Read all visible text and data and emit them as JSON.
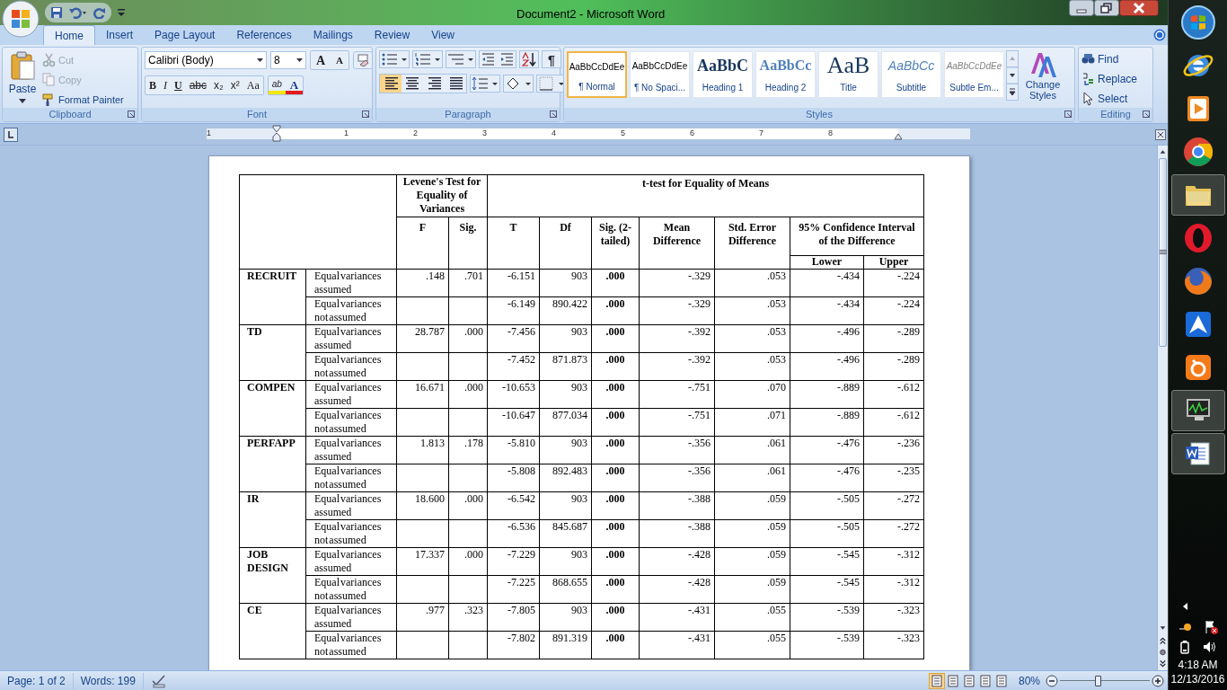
{
  "window": {
    "title": "Document2 - Microsoft Word"
  },
  "ribbon": {
    "tabs": [
      {
        "label": "Home",
        "selected": true
      },
      {
        "label": "Insert",
        "selected": false
      },
      {
        "label": "Page Layout",
        "selected": false
      },
      {
        "label": "References",
        "selected": false
      },
      {
        "label": "Mailings",
        "selected": false
      },
      {
        "label": "Review",
        "selected": false
      },
      {
        "label": "View",
        "selected": false
      }
    ],
    "clipboard": {
      "label": "Clipboard",
      "paste": "Paste",
      "items": [
        {
          "kind": "cut",
          "label": "Cut",
          "disabled": true
        },
        {
          "kind": "copy",
          "label": "Copy",
          "disabled": true
        },
        {
          "kind": "painter",
          "label": "Format Painter",
          "disabled": false
        }
      ]
    },
    "font": {
      "label": "Font",
      "family": "Calibri (Body)",
      "size": "8",
      "grow": "A",
      "shrink": "A",
      "buttons": [
        "B",
        "I",
        "U",
        "abc",
        "x₂",
        "x²",
        "Aa"
      ],
      "highlight": "ab",
      "font_color_button": "A"
    },
    "paragraph": {
      "label": "Paragraph",
      "pilcrow": "¶",
      "alignments": [
        {
          "selected": true
        },
        {
          "selected": false
        },
        {
          "selected": false
        },
        {
          "selected": false
        }
      ]
    },
    "styles": {
      "label": "Styles",
      "items": [
        {
          "preview": "AaBbCcDdEe",
          "name": "¶ Normal",
          "kind": "normal",
          "selected": true
        },
        {
          "preview": "AaBbCcDdEe",
          "name": "¶ No Spaci...",
          "kind": "normal",
          "selected": false
        },
        {
          "preview": "AaBbC",
          "name": "Heading 1",
          "kind": "heading1",
          "selected": false
        },
        {
          "preview": "AaBbCc",
          "name": "Heading 2",
          "kind": "heading2",
          "selected": false
        },
        {
          "preview": "AaB",
          "name": "Title",
          "kind": "title",
          "selected": false
        },
        {
          "preview": "AaBbCc",
          "name": "Subtitle",
          "kind": "subtitle",
          "selected": false
        },
        {
          "preview": "AaBbCcDdEe",
          "name": "Subtle Em...",
          "kind": "subtle",
          "selected": false
        }
      ],
      "change_styles": "Change Styles"
    },
    "editing": {
      "label": "Editing",
      "items": [
        {
          "kind": "find",
          "label": "Find"
        },
        {
          "kind": "replace",
          "label": "Replace"
        },
        {
          "kind": "select",
          "label": "Select"
        }
      ]
    }
  },
  "ruler": {
    "numbers": [
      "1",
      "1",
      "2",
      "3",
      "4",
      "5",
      "6",
      "7",
      "8"
    ]
  },
  "table": {
    "levene": "Levene's Test for Equality of Variances",
    "ttest": "t-test for Equality of Means",
    "columns": [
      "F",
      "Sig.",
      "T",
      "Df",
      "Sig. (2-tailed)",
      "Mean Difference",
      "Std. Error Difference"
    ],
    "ci": "95% Confidence Interval of the Difference",
    "ci_columns": [
      "Lower",
      "Upper"
    ],
    "groups": [
      {
        "name": "RECRUIT",
        "rows": [
          {
            "label": "Equal variances assumed",
            "values": [
              ".148",
              ".701",
              "-6.151",
              "903",
              ".000",
              "-.329",
              ".053",
              "-.434",
              "-.224"
            ]
          },
          {
            "label": "Equal variances not assumed",
            "values": [
              "-6.149",
              "890.422",
              ".000",
              "-.329",
              ".053",
              "-.434",
              "-.224"
            ]
          }
        ]
      },
      {
        "name": "TD",
        "rows": [
          {
            "label": "Equal variances assumed",
            "values": [
              "28.787",
              ".000",
              "-7.456",
              "903",
              ".000",
              "-.392",
              ".053",
              "-.496",
              "-.289"
            ]
          },
          {
            "label": "Equal variances not assumed",
            "values": [
              "-7.452",
              "871.873",
              ".000",
              "-.392",
              ".053",
              "-.496",
              "-.289"
            ]
          }
        ]
      },
      {
        "name": "COMPEN",
        "rows": [
          {
            "label": "Equal variances assumed",
            "values": [
              "16.671",
              ".000",
              "-10.653",
              "903",
              ".000",
              "-.751",
              ".070",
              "-.889",
              "-.612"
            ]
          },
          {
            "label": "Equal variances not assumed",
            "values": [
              "-10.647",
              "877.034",
              ".000",
              "-.751",
              ".071",
              "-.889",
              "-.612"
            ]
          }
        ]
      },
      {
        "name": "PERFAPP",
        "rows": [
          {
            "label": "Equal variances assumed",
            "values": [
              "1.813",
              ".178",
              "-5.810",
              "903",
              ".000",
              "-.356",
              ".061",
              "-.476",
              "-.236"
            ]
          },
          {
            "label": "Equal variances not assumed",
            "values": [
              "-5.808",
              "892.483",
              ".000",
              "-.356",
              ".061",
              "-.476",
              "-.235"
            ]
          }
        ]
      },
      {
        "name": "IR",
        "rows": [
          {
            "label": "Equal variances assumed",
            "values": [
              "18.600",
              ".000",
              "-6.542",
              "903",
              ".000",
              "-.388",
              ".059",
              "-.505",
              "-.272"
            ]
          },
          {
            "label": "Equal variances not assumed",
            "values": [
              "-6.536",
              "845.687",
              ".000",
              "-.388",
              ".059",
              "-.505",
              "-.272"
            ]
          }
        ]
      },
      {
        "name": "JOB DESIGN",
        "rows": [
          {
            "label": "Equal variances assumed",
            "values": [
              "17.337",
              ".000",
              "-7.229",
              "903",
              ".000",
              "-.428",
              ".059",
              "-.545",
              "-.312"
            ]
          },
          {
            "label": "Equal variances not assumed",
            "values": [
              "-7.225",
              "868.655",
              ".000",
              "-.428",
              ".059",
              "-.545",
              "-.312"
            ]
          }
        ]
      },
      {
        "name": "CE",
        "rows": [
          {
            "label": "Equal variances assumed",
            "values": [
              ".977",
              ".323",
              "-7.805",
              "903",
              ".000",
              "-.431",
              ".055",
              "-.539",
              "-.323"
            ]
          },
          {
            "label": "Equal variances not assumed",
            "values": [
              "-7.802",
              "891.319",
              ".000",
              "-.431",
              ".055",
              "-.539",
              "-.323"
            ]
          }
        ]
      }
    ]
  },
  "status_bar": {
    "page": "Page: 1 of 2",
    "words": "Words: 199",
    "views": [
      {
        "selected": true
      },
      {
        "selected": false
      },
      {
        "selected": false
      },
      {
        "selected": false
      },
      {
        "selected": false
      }
    ],
    "zoom": "80%",
    "level": 0.42
  },
  "taskbar": {
    "apps": [
      {
        "kind": "start",
        "running": false
      },
      {
        "kind": "ie",
        "running": false
      },
      {
        "kind": "media",
        "running": false
      },
      {
        "kind": "chrome",
        "running": false
      },
      {
        "kind": "folder",
        "running": true
      },
      {
        "kind": "opera",
        "running": false
      },
      {
        "kind": "firefox",
        "running": false
      },
      {
        "kind": "arrow",
        "running": false
      },
      {
        "kind": "uc",
        "running": false
      },
      {
        "kind": "monitor",
        "running": true
      },
      {
        "kind": "word",
        "running": true
      }
    ],
    "time": "4:18 AM",
    "date": "12/13/2016"
  }
}
